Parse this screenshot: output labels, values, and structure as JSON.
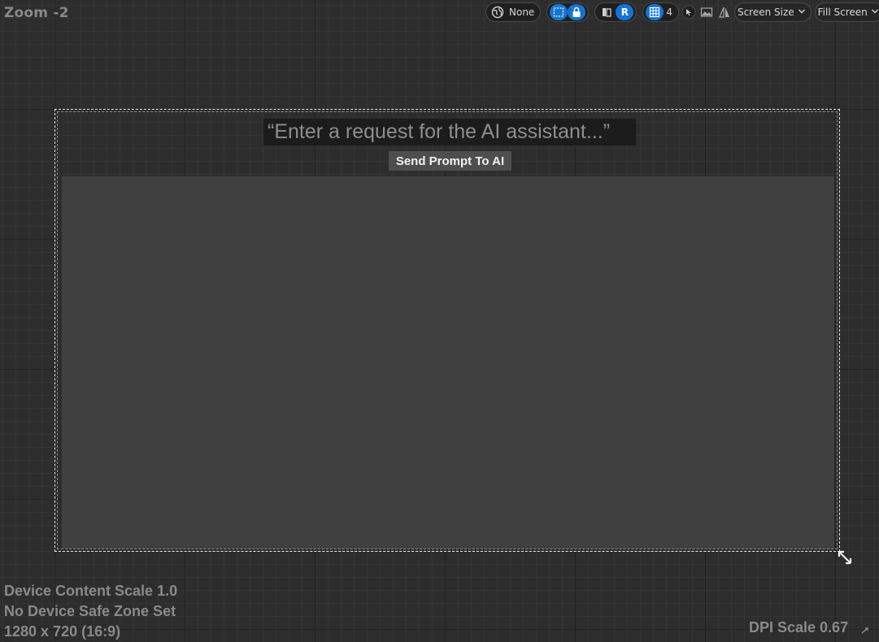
{
  "viewport": {
    "zoom_label": "Zoom -2"
  },
  "toolbar": {
    "locale_value": "None",
    "right_to_left_label": "R",
    "grid_count": "4",
    "screen_size_label": "Screen Size",
    "fill_screen_label": "Fill Screen"
  },
  "widget": {
    "prompt_placeholder": "“Enter a request for the AI assistant...”",
    "send_button_label": "Send Prompt To AI"
  },
  "footer": {
    "content_scale": "Device Content Scale 1.0",
    "safe_zone": "No Device Safe Zone Set",
    "resolution": "1280 x 720 (16:9)",
    "dpi_scale": "DPI Scale 0.67"
  },
  "colors": {
    "accent": "#1474d4",
    "background": "#2d2d2d",
    "content": "#404040"
  },
  "icons": [
    "globe-icon",
    "marquee-select-icon",
    "lock-icon",
    "layout-icon",
    "grid-icon",
    "cursor-icon",
    "image-icon",
    "mirror-icon",
    "chevron-down-icon",
    "resize-icon"
  ]
}
